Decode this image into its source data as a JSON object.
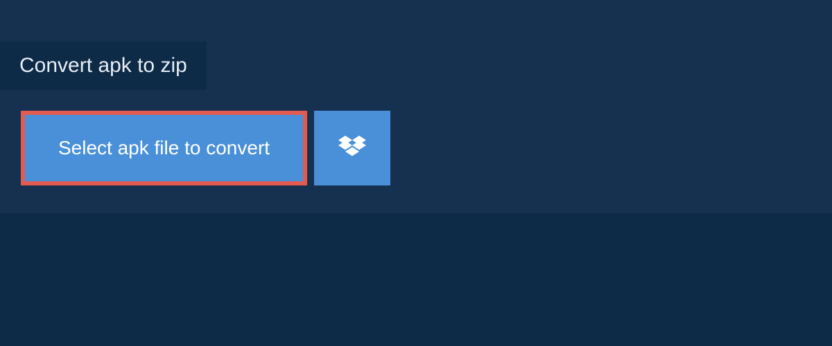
{
  "header": {
    "tab_label": "Convert apk to zip"
  },
  "actions": {
    "select_button_label": "Select apk file to convert",
    "cloud_source": "dropbox"
  },
  "colors": {
    "background_dark": "#0d2a47",
    "panel": "#163150",
    "button_blue": "#4a90d9",
    "highlight_border": "#e25a50"
  }
}
